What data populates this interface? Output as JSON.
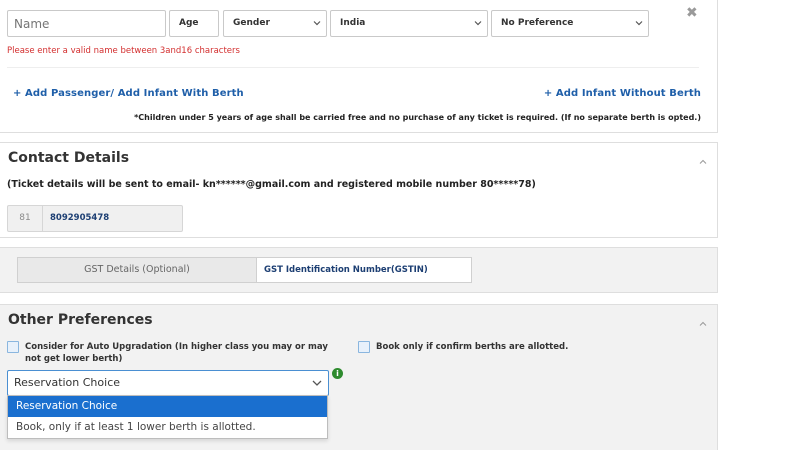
{
  "passenger": {
    "name_placeholder": "Name",
    "age_placeholder": "Age",
    "gender_label": "Gender",
    "country_value": "India",
    "berth_preference": "No Preference",
    "error_text": "Please enter a valid name between 3and16 characters",
    "add_passenger_link": "+ Add Passenger/ Add Infant With Berth",
    "add_infant_link": "+ Add Infant Without Berth",
    "children_note": "*Children under 5 years of age shall be carried free and no purchase of any ticket is required. (If no separate berth is opted.)",
    "close_symbol": "✖"
  },
  "contact": {
    "title": "Contact Details",
    "note": "(Ticket details will be sent to email- kn******@gmail.com and registered mobile number 80*****78)",
    "country_code": "81",
    "mobile": "8092905478"
  },
  "gst": {
    "label": "GST Details (Optional)",
    "input_placeholder": "GST Identification Number(GSTIN)"
  },
  "preferences": {
    "title": "Other Preferences",
    "auto_upgrade_label": "Consider for Auto Upgradation (In higher class you may or may not get lower berth)",
    "confirm_berth_label": "Book only if confirm berths are allotted.",
    "reservation_select": "Reservation Choice",
    "info_symbol": "i",
    "options": [
      "Reservation Choice",
      "Book, only if at least 1 lower berth is allotted."
    ]
  },
  "colors": {
    "link": "#1f5fa9",
    "error": "#d32f2f",
    "selected_option": "#1a6fcf"
  }
}
